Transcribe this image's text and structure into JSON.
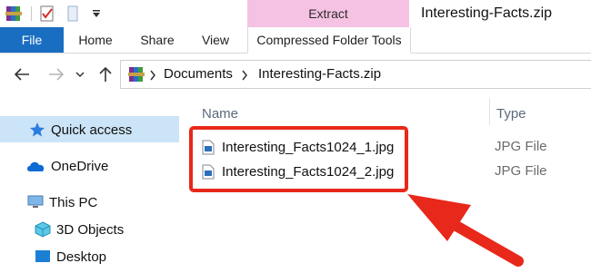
{
  "window": {
    "title": "Interesting-Facts.zip"
  },
  "quick_access_toolbar": {
    "icons": [
      "winrar-icon",
      "properties-checkmark-icon",
      "new-folder-icon",
      "dropdown-arrow-icon"
    ]
  },
  "ribbon": {
    "context_group": "Extract",
    "tabs": [
      {
        "label": "File"
      },
      {
        "label": "Home"
      },
      {
        "label": "Share"
      },
      {
        "label": "View"
      },
      {
        "label": "Compressed Folder Tools"
      }
    ]
  },
  "navigation": {
    "back": "arrow-left-icon",
    "forward": "arrow-right-icon",
    "recent": "chevron-down-icon",
    "up": "arrow-up-icon"
  },
  "address": {
    "breadcrumbs": [
      "Documents",
      "Interesting-Facts.zip"
    ]
  },
  "nav_pane": {
    "items": [
      {
        "label": "Quick access",
        "icon": "star-icon",
        "selected": true
      },
      {
        "label": "OneDrive",
        "icon": "cloud-icon"
      },
      {
        "label": "This PC",
        "icon": "computer-icon"
      },
      {
        "label": "3D Objects",
        "icon": "cube-icon"
      },
      {
        "label": "Desktop",
        "icon": "desktop-icon"
      }
    ]
  },
  "file_list": {
    "columns": [
      "Name",
      "Type"
    ],
    "rows": [
      {
        "name": "Interesting_Facts1024_1.jpg",
        "type": "JPG File"
      },
      {
        "name": "Interesting_Facts1024_2.jpg",
        "type": "JPG File"
      }
    ]
  },
  "colors": {
    "accent": "#1a6ec2",
    "extract_tab": "#f6c2e3",
    "highlight": "#e8281a",
    "selection": "#cce4f7"
  }
}
